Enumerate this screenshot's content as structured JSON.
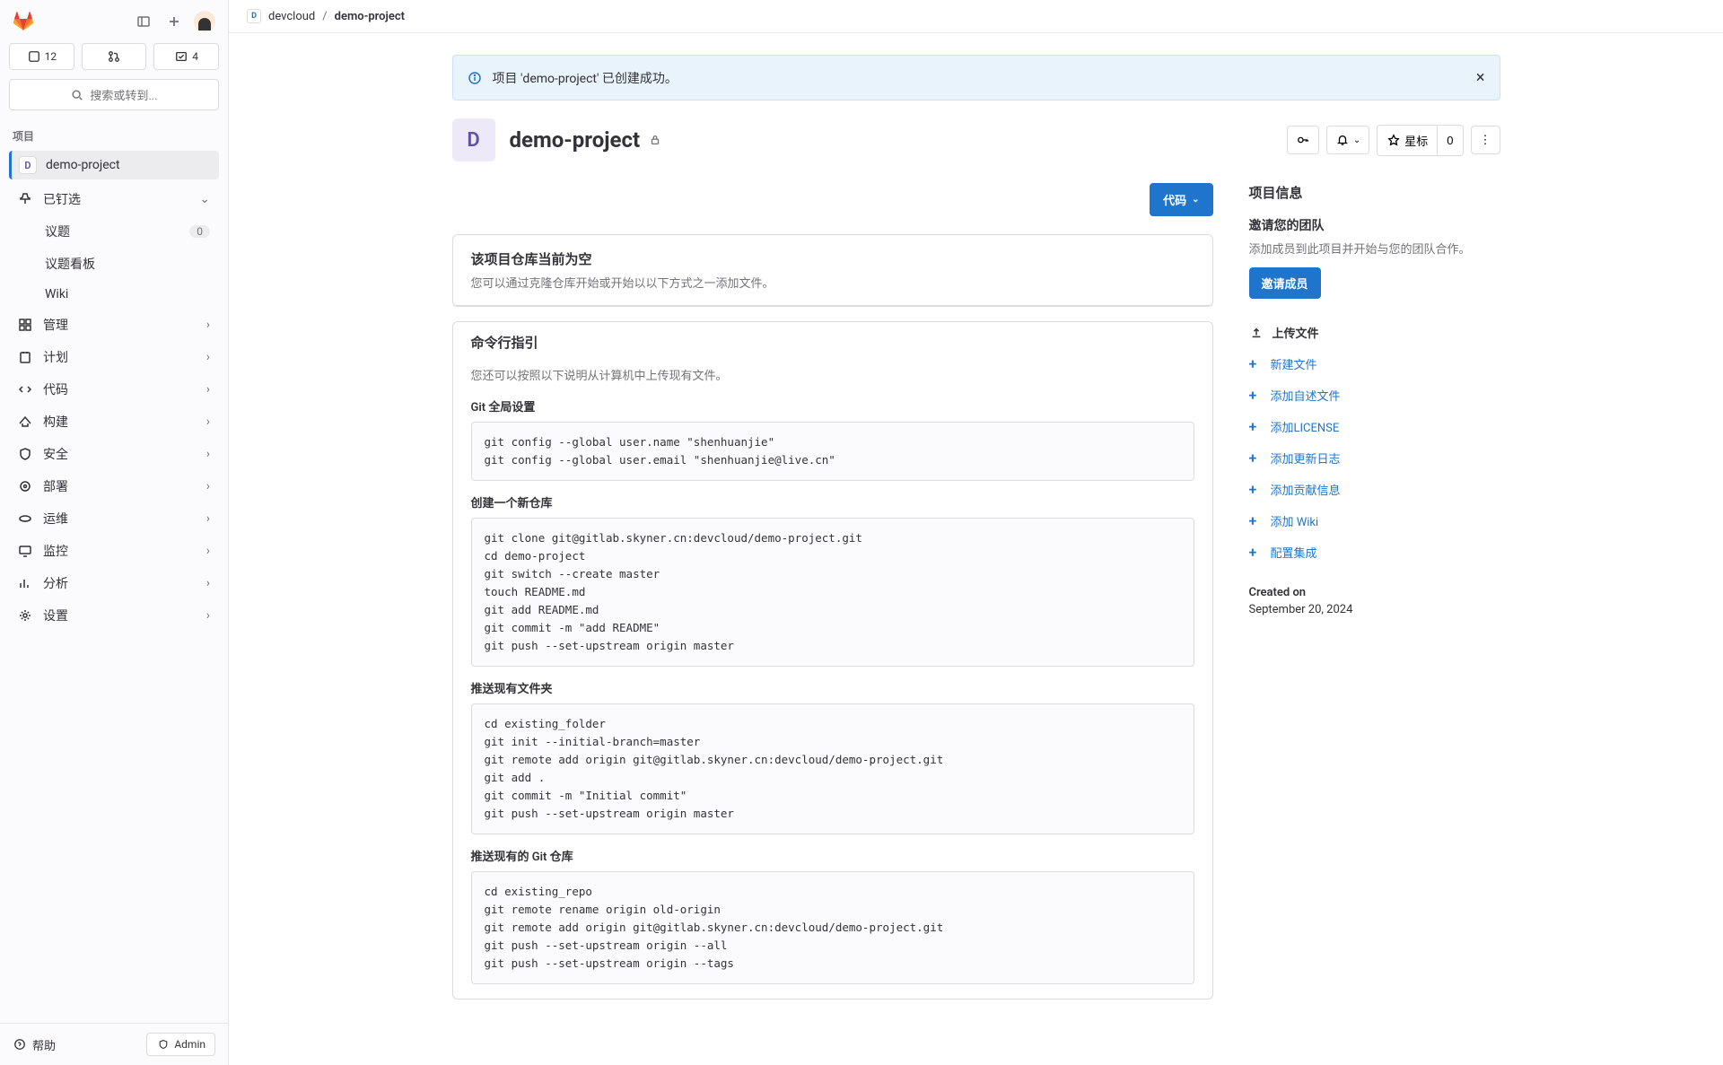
{
  "sidebar": {
    "stats": {
      "issues": "12",
      "mrs": "",
      "todos": "4"
    },
    "search_placeholder": "搜索或转到...",
    "section_title": "项目",
    "project": {
      "initial": "D",
      "name": "demo-project"
    },
    "pinned_label": "已钉选",
    "pinned": [
      {
        "label": "议题",
        "count": "0"
      },
      {
        "label": "议题看板"
      },
      {
        "label": "Wiki"
      }
    ],
    "nav": [
      {
        "label": "管理"
      },
      {
        "label": "计划"
      },
      {
        "label": "代码"
      },
      {
        "label": "构建"
      },
      {
        "label": "安全"
      },
      {
        "label": "部署"
      },
      {
        "label": "运维"
      },
      {
        "label": "监控"
      },
      {
        "label": "分析"
      },
      {
        "label": "设置"
      }
    ],
    "help": "帮助",
    "admin": "Admin"
  },
  "breadcrumb": {
    "group": "devcloud",
    "project": "demo-project"
  },
  "alert": {
    "text": "项目 'demo-project' 已创建成功。"
  },
  "header": {
    "initial": "D",
    "title": "demo-project",
    "star_label": "星标",
    "star_count": "0"
  },
  "code_btn": "代码",
  "empty_panel": {
    "title": "该项目仓库当前为空",
    "subtitle": "您可以通过克隆仓库开始或开始以以下方式之一添加文件。"
  },
  "cli_title": "命令行指引",
  "upload_note": "您还可以按照以下说明从计算机中上传现有文件。",
  "sections": {
    "git_global": {
      "title": "Git 全局设置",
      "code": "git config --global user.name \"shenhuanjie\"\ngit config --global user.email \"shenhuanjie@live.cn\""
    },
    "create_new": {
      "title": "创建一个新仓库",
      "code": "git clone git@gitlab.skyner.cn:devcloud/demo-project.git\ncd demo-project\ngit switch --create master\ntouch README.md\ngit add README.md\ngit commit -m \"add README\"\ngit push --set-upstream origin master"
    },
    "push_folder": {
      "title": "推送现有文件夹",
      "code": "cd existing_folder\ngit init --initial-branch=master\ngit remote add origin git@gitlab.skyner.cn:devcloud/demo-project.git\ngit add .\ngit commit -m \"Initial commit\"\ngit push --set-upstream origin master"
    },
    "push_repo": {
      "title": "推送现有的 Git 仓库",
      "code": "cd existing_repo\ngit remote rename origin old-origin\ngit remote add origin git@gitlab.skyner.cn:devcloud/demo-project.git\ngit push --set-upstream origin --all\ngit push --set-upstream origin --tags"
    }
  },
  "side": {
    "info_title": "项目信息",
    "invite_title": "邀请您的团队",
    "invite_text": "添加成员到此项目并开始与您的团队合作。",
    "invite_btn": "邀请成员",
    "upload": "上传文件",
    "actions": [
      "新建文件",
      "添加自述文件",
      "添加LICENSE",
      "添加更新日志",
      "添加贡献信息",
      "添加 Wiki",
      "配置集成"
    ],
    "created_label": "Created on",
    "created_val": "September 20, 2024"
  }
}
